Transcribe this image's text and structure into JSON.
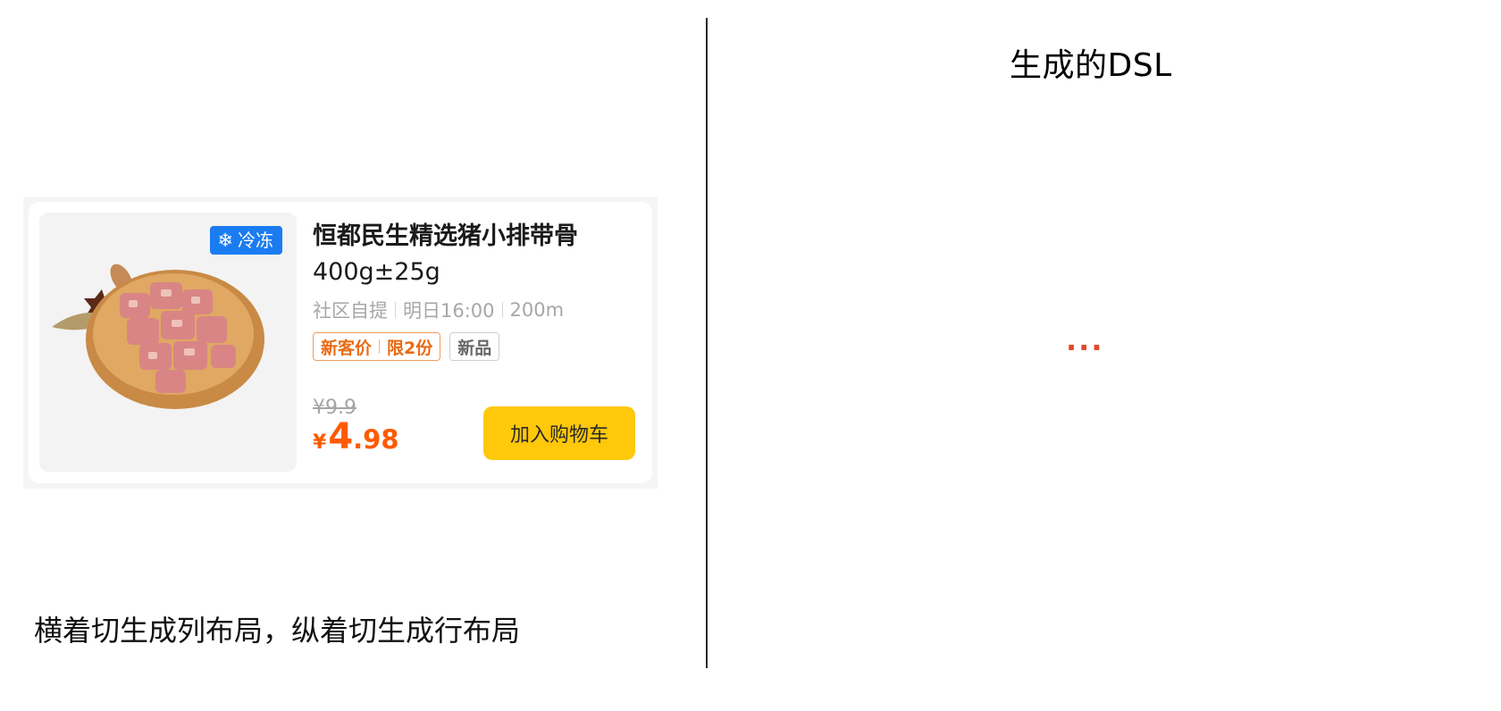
{
  "right_panel": {
    "title": "生成的DSL",
    "ellipsis": "..."
  },
  "caption": "横着切生成列布局，纵着切生成行布局",
  "product_card": {
    "badge": {
      "icon": "snowflake-icon",
      "label": "冷冻",
      "color": "#1b7cf1"
    },
    "title_line1": "恒都民生精选猪小排带骨",
    "title_line2": "400g±25g",
    "meta": [
      "社区自提",
      "明日16:00",
      "200m"
    ],
    "promo_tag": {
      "part1": "新客价",
      "part2": "限2份",
      "color": "#ea6a12"
    },
    "new_tag": "新品",
    "original_price": "¥9.9",
    "price": {
      "currency": "¥",
      "integer": "4",
      "decimal": ".98",
      "color": "#ff5a00"
    },
    "cart_button": {
      "label": "加入购物车",
      "color": "#ffc80a"
    }
  }
}
